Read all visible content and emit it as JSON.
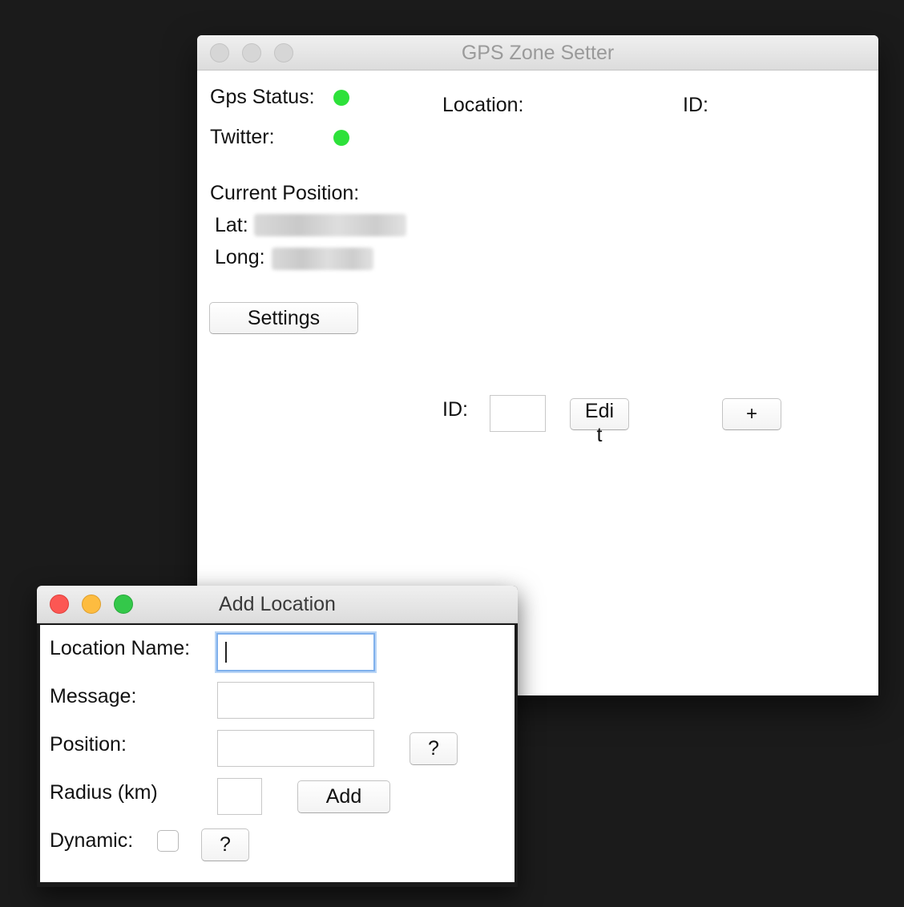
{
  "main_window": {
    "title": "GPS Zone Setter",
    "gps_status_label": "Gps Status:",
    "twitter_label": "Twitter:",
    "status_color": "#2de13a",
    "current_position_label": "Current Position:",
    "lat_label": "Lat:",
    "long_label": "Long:",
    "settings_button": "Settings",
    "location_header": "Location:",
    "id_header": "ID:",
    "id_label": "ID:",
    "id_value": "",
    "edit_button": "Edi\nt",
    "add_button": "+"
  },
  "add_window": {
    "title": "Add Location",
    "location_name_label": "Location Name:",
    "location_name_value": "",
    "message_label": "Message:",
    "message_value": "",
    "position_label": "Position:",
    "position_value": "",
    "position_help_button": "?",
    "radius_label": "Radius (km)",
    "radius_value": "",
    "add_button": "Add",
    "dynamic_label": "Dynamic:",
    "dynamic_checked": false,
    "dynamic_help_button": "?"
  }
}
